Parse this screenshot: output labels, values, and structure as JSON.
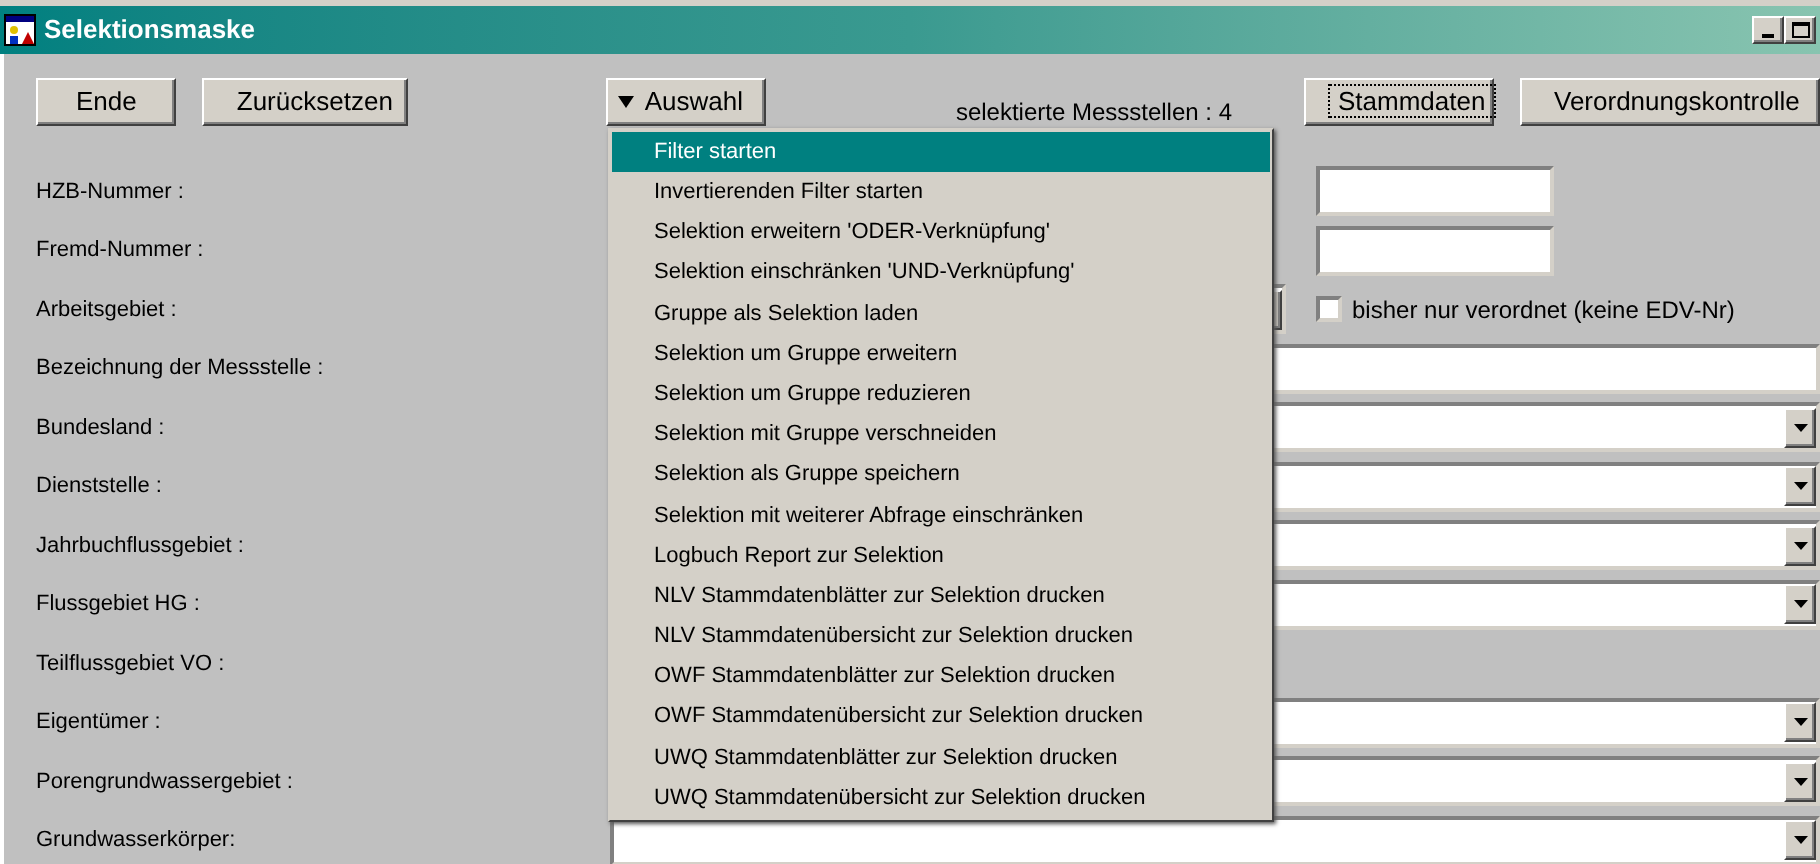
{
  "window": {
    "title": "Selektionsmaske"
  },
  "toolbar": {
    "buttons": [
      {
        "label": "Ende",
        "focused": false
      },
      {
        "label": "Zurücksetzen",
        "focused": false
      }
    ],
    "menu_button": {
      "label": "Auswahl",
      "expanded": true
    },
    "count_text": "selektierte Messstellen : 4",
    "right_buttons": [
      {
        "label": "Stammdaten",
        "focused": true
      },
      {
        "label": "Verordnungskontrolle",
        "focused": false
      }
    ]
  },
  "form": [
    {
      "label": "HZB-Nummer :",
      "kind": "short_text"
    },
    {
      "label": "Fremd-Nummer :",
      "kind": "short_text"
    },
    {
      "label": "Arbeitsgebiet :",
      "kind": "combo_checkbox",
      "checkbox": {
        "label": "bisher nur verordnet (keine EDV-Nr)",
        "checked": false
      }
    },
    {
      "label": "Bezeichnung der Messstelle :",
      "kind": "text"
    },
    {
      "label": "Bundesland :",
      "kind": "combo"
    },
    {
      "label": "Dienststelle :",
      "kind": "combo"
    },
    {
      "label": "Jahrbuchflussgebiet :",
      "kind": "combo"
    },
    {
      "label": "Flussgebiet HG :",
      "kind": "combo"
    },
    {
      "label": "Teilflussgebiet VO :",
      "kind": "none"
    },
    {
      "label": "Eigentümer :",
      "kind": "combo"
    },
    {
      "label": "Porengrundwassergebiet :",
      "kind": "combo"
    },
    {
      "label": "Grundwasserkörper:",
      "kind": "combo"
    }
  ],
  "menu": [
    {
      "label": "Filter starten",
      "selected": true
    },
    {
      "label": "Invertierenden Filter starten",
      "selected": false
    },
    {
      "label": "Selektion erweitern 'ODER-Verknüpfung'",
      "selected": false
    },
    {
      "label": "Selektion einschränken 'UND-Verknüpfung'",
      "selected": false
    },
    {
      "label": "Gruppe als Selektion laden",
      "selected": false
    },
    {
      "label": "Selektion um Gruppe erweitern",
      "selected": false
    },
    {
      "label": "Selektion um Gruppe reduzieren",
      "selected": false
    },
    {
      "label": "Selektion mit Gruppe verschneiden",
      "selected": false
    },
    {
      "label": "Selektion als Gruppe speichern",
      "selected": false
    },
    {
      "label": "Selektion mit weiterer Abfrage einschränken",
      "selected": false
    },
    {
      "label": "Logbuch Report zur Selektion",
      "selected": false
    },
    {
      "label": "NLV Stammdatenblätter zur Selektion drucken",
      "selected": false
    },
    {
      "label": "NLV Stammdatenübersicht zur Selektion drucken",
      "selected": false
    },
    {
      "label": "OWF Stammdatenblätter zur Selektion drucken",
      "selected": false
    },
    {
      "label": "OWF Stammdatenübersicht zur Selektion drucken",
      "selected": false
    },
    {
      "label": "UWQ Stammdatenblätter zur Selektion drucken",
      "selected": false
    },
    {
      "label": "UWQ Stammdatenübersicht zur Selektion drucken",
      "selected": false
    }
  ]
}
